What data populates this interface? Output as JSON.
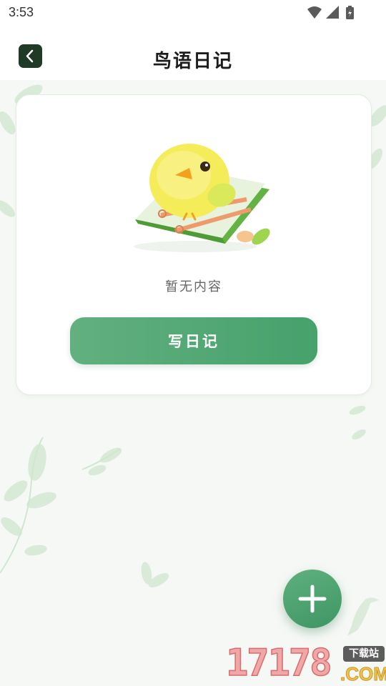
{
  "status_bar": {
    "time": "3:53",
    "icons": [
      "wifi-icon",
      "signal-icon",
      "battery-charging-icon"
    ]
  },
  "header": {
    "back_icon": "chevron-left-icon",
    "title": "鸟语日记"
  },
  "empty_state": {
    "illustration": "bird-on-notebook-illustration",
    "message": "暂无内容",
    "write_button_label": "写日记"
  },
  "fab": {
    "icon": "plus-icon"
  },
  "watermark": {
    "number": "17178",
    "badge": "下载站",
    "domain": ".COM"
  },
  "colors": {
    "accent_green": "#4fa673",
    "back_button": "#1f3b26",
    "background": "#f6f8f5"
  }
}
